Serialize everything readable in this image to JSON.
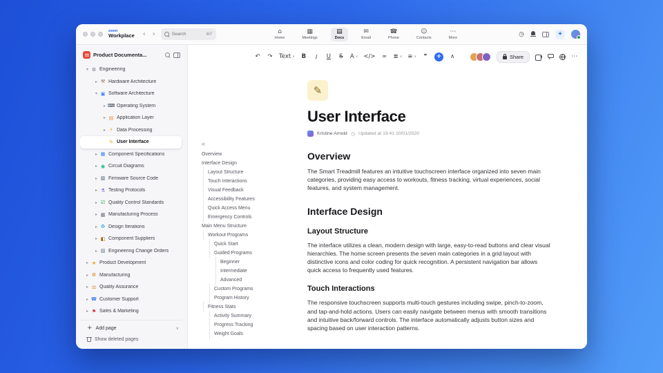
{
  "icons": {
    "back": "‹",
    "forward": "›",
    "history": "◷",
    "plus": "+",
    "caret_down": "∨",
    "outline_collapse": "«",
    "clock": "◷",
    "more": "⋯"
  },
  "titlebar": {
    "logo_top": "zoom",
    "logo_bottom": "Workplace",
    "search_placeholder": "Search",
    "search_shortcut": "⌘F",
    "tabs": [
      {
        "name": "tab-home",
        "label": "Home",
        "icon": "⌂"
      },
      {
        "name": "tab-meetings",
        "label": "Meetings",
        "icon": "▦"
      },
      {
        "name": "tab-docs",
        "label": "Docs",
        "icon": "▤",
        "active": true
      },
      {
        "name": "tab-email",
        "label": "Email",
        "icon": "✉"
      },
      {
        "name": "tab-phone",
        "label": "Phone",
        "icon": "☎"
      },
      {
        "name": "tab-contacts",
        "label": "Contacts",
        "icon": "☺"
      },
      {
        "name": "tab-more",
        "label": "More",
        "icon": "⋯"
      }
    ]
  },
  "sidebar": {
    "title": "Product Documenta...",
    "add_page": "Add page",
    "show_deleted": "Show deleted pages",
    "tree": [
      {
        "label": "Engineering",
        "level": 0,
        "icon": "⚙",
        "icon_color": "#6b7280",
        "chevron": "down"
      },
      {
        "label": "Hardware Architecture",
        "level": 1,
        "icon": "⚒",
        "icon_color": "#8d6e4a",
        "chevron": "right"
      },
      {
        "label": "Software Architecture",
        "level": 1,
        "icon": "▣",
        "icon_color": "#3b82f6",
        "chevron": "down"
      },
      {
        "label": "Operating System",
        "level": 2,
        "icon": "⌨",
        "icon_color": "#374151",
        "chevron": "right"
      },
      {
        "label": "Application Layer",
        "level": 2,
        "icon": "▤",
        "icon_color": "#f08c2e",
        "chevron": "right"
      },
      {
        "label": "Data Processing",
        "level": 2,
        "icon": "⚡",
        "icon_color": "#d9a406",
        "chevron": "right"
      },
      {
        "label": "User Interface",
        "level": 2,
        "icon": "✎",
        "icon_color": "#f59e0b",
        "chevron": "none",
        "selected": true
      },
      {
        "label": "Component Specifications",
        "level": 1,
        "icon": "▦",
        "icon_color": "#3b82f6",
        "chevron": "right"
      },
      {
        "label": "Circuit Diagrams",
        "level": 1,
        "icon": "◉",
        "icon_color": "#10b981",
        "chevron": "right"
      },
      {
        "label": "Firmware Source Code",
        "level": 1,
        "icon": "▥",
        "icon_color": "#475569",
        "chevron": "right"
      },
      {
        "label": "Testing Protocols",
        "level": 1,
        "icon": "⚗",
        "icon_color": "#8b5cf6",
        "chevron": "right"
      },
      {
        "label": "Quality Control Standards",
        "level": 1,
        "icon": "☑",
        "icon_color": "#16a34a",
        "chevron": "right"
      },
      {
        "label": "Manufacturing Process",
        "level": 1,
        "icon": "▩",
        "icon_color": "#6b7280",
        "chevron": "right"
      },
      {
        "label": "Design Iterations",
        "level": 1,
        "icon": "♻",
        "icon_color": "#0ea5e9",
        "chevron": "right"
      },
      {
        "label": "Component Suppliers",
        "level": 1,
        "icon": "◧",
        "icon_color": "#a16207",
        "chevron": "right"
      },
      {
        "label": "Engineering Change Orders",
        "level": 1,
        "icon": "▧",
        "icon_color": "#64748b",
        "chevron": "right"
      },
      {
        "label": "Product Development",
        "level": 0,
        "icon": "★",
        "icon_color": "#f59e0b",
        "chevron": "right"
      },
      {
        "label": "Manufacturing",
        "level": 0,
        "icon": "⚙",
        "icon_color": "#d97706",
        "chevron": "right"
      },
      {
        "label": "Quality Assurance",
        "level": 0,
        "icon": "⚖",
        "icon_color": "#ca8a04",
        "chevron": "right"
      },
      {
        "label": "Customer Support",
        "level": 0,
        "icon": "☎",
        "icon_color": "#3b82f6",
        "chevron": "right"
      },
      {
        "label": "Sales & Marketing",
        "level": 0,
        "icon": "⚑",
        "icon_color": "#dc2626",
        "chevron": "right"
      }
    ]
  },
  "doc_toolbar": {
    "share_label": "Share",
    "buttons": [
      {
        "name": "undo-button",
        "glyph": "↶"
      },
      {
        "name": "redo-button",
        "glyph": "↷"
      },
      {
        "name": "text-style-dropdown",
        "glyph": "Text",
        "dropdown": true
      },
      {
        "name": "bold-button",
        "glyph": "B",
        "cls": "bold"
      },
      {
        "name": "italic-button",
        "glyph": "I",
        "cls": "italic"
      },
      {
        "name": "underline-button",
        "glyph": "U",
        "cls": "underline"
      },
      {
        "name": "strikethrough-button",
        "glyph": "S",
        "cls": "strike"
      },
      {
        "name": "text-color-button",
        "glyph": "A",
        "dropdown": true
      },
      {
        "name": "code-button",
        "glyph": "</>"
      },
      {
        "name": "link-button",
        "glyph": "∞"
      },
      {
        "name": "bullet-list-button",
        "glyph": "≣",
        "dropdown": true
      },
      {
        "name": "alignment-button",
        "glyph": "≡",
        "dropdown": true
      },
      {
        "name": "comment-button",
        "glyph": "❞"
      },
      {
        "name": "insert-plus-button",
        "glyph": "+",
        "cls": "plus"
      },
      {
        "name": "collapse-toolbar-button",
        "glyph": "∧"
      }
    ],
    "collaborators": [
      {
        "color": "#e2a14e"
      },
      {
        "color": "#c96f6f"
      },
      {
        "color": "#7f62c3"
      }
    ]
  },
  "outline": {
    "items": [
      {
        "label": "Overview",
        "level": 0
      },
      {
        "label": "Interface Design",
        "level": 0
      },
      {
        "label": "Layout Structure",
        "level": 1
      },
      {
        "label": "Touch Interactions",
        "level": 1
      },
      {
        "label": "Visual Feedback",
        "level": 1
      },
      {
        "label": "Accessibility Features",
        "level": 1
      },
      {
        "label": "Quick Access Menu",
        "level": 1
      },
      {
        "label": "Emergency Controls",
        "level": 1
      },
      {
        "label": "Main Menu Structure",
        "level": 0
      },
      {
        "label": "Workout Programs",
        "level": 1
      },
      {
        "label": "Quick Start",
        "level": 2
      },
      {
        "label": "Guided Programs",
        "level": 2
      },
      {
        "label": "Beginner",
        "level": 3
      },
      {
        "label": "Intermediate",
        "level": 3
      },
      {
        "label": "Advanced",
        "level": 3
      },
      {
        "label": "Custom Programs",
        "level": 2
      },
      {
        "label": "Program History",
        "level": 2
      },
      {
        "label": "Fitness Stats",
        "level": 1
      },
      {
        "label": "Activity Summary",
        "level": 2
      },
      {
        "label": "Progress Tracking",
        "level": 2
      },
      {
        "label": "Weight Goals",
        "level": 2
      }
    ]
  },
  "doc": {
    "icon": "✎",
    "title": "User Interface",
    "author": "Kristine Arnold",
    "updated": "Updated at 19:41 10/01/2020",
    "sections": [
      {
        "type": "h2",
        "text": "Overview"
      },
      {
        "type": "p",
        "text": "The Smart Treadmill features an intuitive touchscreen interface organized into seven main categories, providing easy access to workouts, fitness tracking, virtual experiences, social features, and system management."
      },
      {
        "type": "h2",
        "text": "Interface Design"
      },
      {
        "type": "h3",
        "text": "Layout Structure"
      },
      {
        "type": "p",
        "text": "The interface utilizes a clean, modern design with large, easy-to-read buttons and clear visual hierarchies. The home screen presents the seven main categories in a grid layout with distinctive icons and color coding for quick recognition. A persistent navigation bar allows quick access to frequently used features."
      },
      {
        "type": "h3",
        "text": "Touch Interactions"
      },
      {
        "type": "p",
        "text": "The responsive touchscreen supports multi-touch gestures including swipe, pinch-to-zoom, and tap-and-hold actions. Users can easily navigate between menus with smooth transitions and intuitive back/forward controls. The interface automatically adjusts button sizes and spacing based on user interaction patterns."
      }
    ]
  }
}
